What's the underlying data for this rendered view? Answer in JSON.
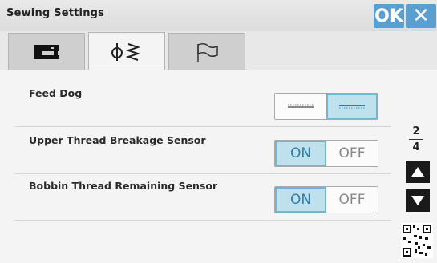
{
  "window": {
    "title": "Sewing Settings"
  },
  "header": {
    "ok_label": "OK",
    "close_label": "✕"
  },
  "tabs": [
    {
      "icon": "sewing-machine-icon",
      "active": false
    },
    {
      "icon": "stitch-settings-icon",
      "active": true
    },
    {
      "icon": "flag-icon",
      "active": false
    }
  ],
  "settings": {
    "feed_dog": {
      "label": "Feed Dog",
      "selected": "lowered"
    },
    "upper_thread": {
      "label": "Upper Thread Breakage Sensor",
      "on_label": "ON",
      "off_label": "OFF",
      "value": "ON"
    },
    "bobbin_thread": {
      "label": "Bobbin Thread Remaining Sensor",
      "on_label": "ON",
      "off_label": "OFF",
      "value": "ON"
    }
  },
  "pager": {
    "current": "2",
    "total": "4"
  },
  "colors": {
    "accent": "#5a9fd0",
    "on_bg": "#bfe1ee",
    "on_text": "#2c7fa9"
  }
}
